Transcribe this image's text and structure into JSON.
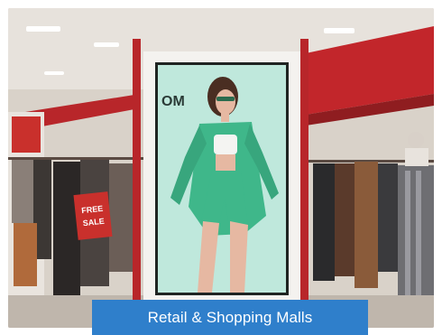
{
  "screen": {
    "ad_text_fragment": "OM",
    "sale_sign_text": "FREE SALE"
  },
  "caption": {
    "label": "Retail & Shopping Malls"
  },
  "colors": {
    "caption_bg": "#2f7fcb",
    "screen_bg": "#bfe8dc",
    "outfit": "#3fb78a",
    "pillar_red": "#b8262a"
  }
}
